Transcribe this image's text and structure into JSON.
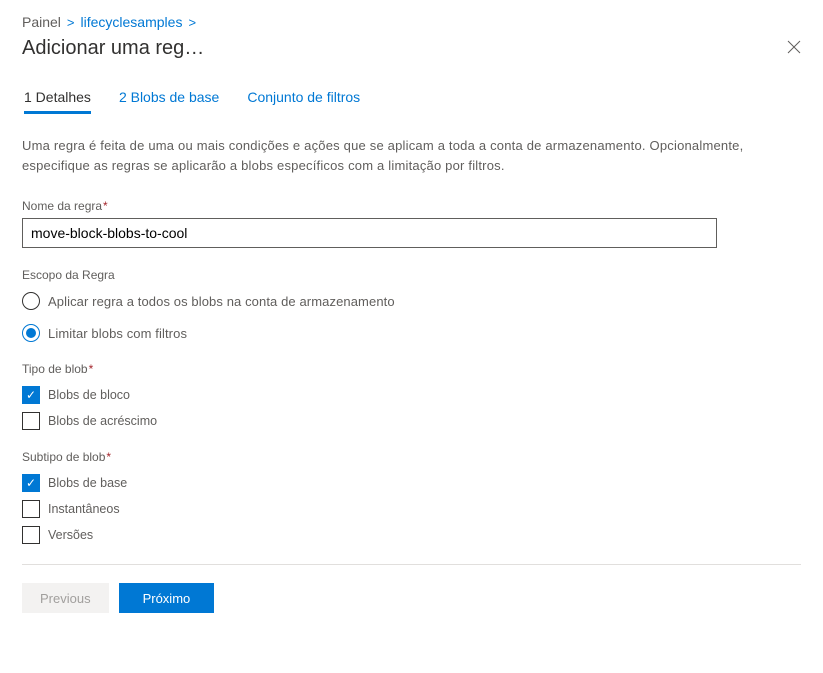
{
  "breadcrumb": {
    "root": "Painel",
    "link": "lifecyclesamples"
  },
  "header": {
    "title": "Adicionar uma reg…"
  },
  "tabs": {
    "t1": "1 Detalhes",
    "t2": "2 Blobs de base",
    "t3": "Conjunto de filtros"
  },
  "description": "Uma regra é feita de uma ou mais condições e ações que se aplicam a toda a conta de armazenamento. Opcionalmente, especifique as regras se aplicarão a blobs específicos com a limitação por filtros.",
  "fields": {
    "ruleName": {
      "label": "Nome da regra",
      "value": "move-block-blobs-to-cool"
    },
    "scope": {
      "label": "Escopo da Regra",
      "options": {
        "all": "Aplicar regra a todos os blobs na conta de armazenamento",
        "filter": "Limitar blobs com filtros"
      }
    },
    "blobType": {
      "label": "Tipo de blob",
      "options": {
        "block": "Blobs de bloco",
        "append": "Blobs de acréscimo"
      }
    },
    "blobSubtype": {
      "label": "Subtipo de blob",
      "options": {
        "base": "Blobs de base",
        "snapshots": "Instantâneos",
        "versions": "Versões"
      }
    }
  },
  "buttons": {
    "prev": "Previous",
    "next": "Próximo"
  }
}
